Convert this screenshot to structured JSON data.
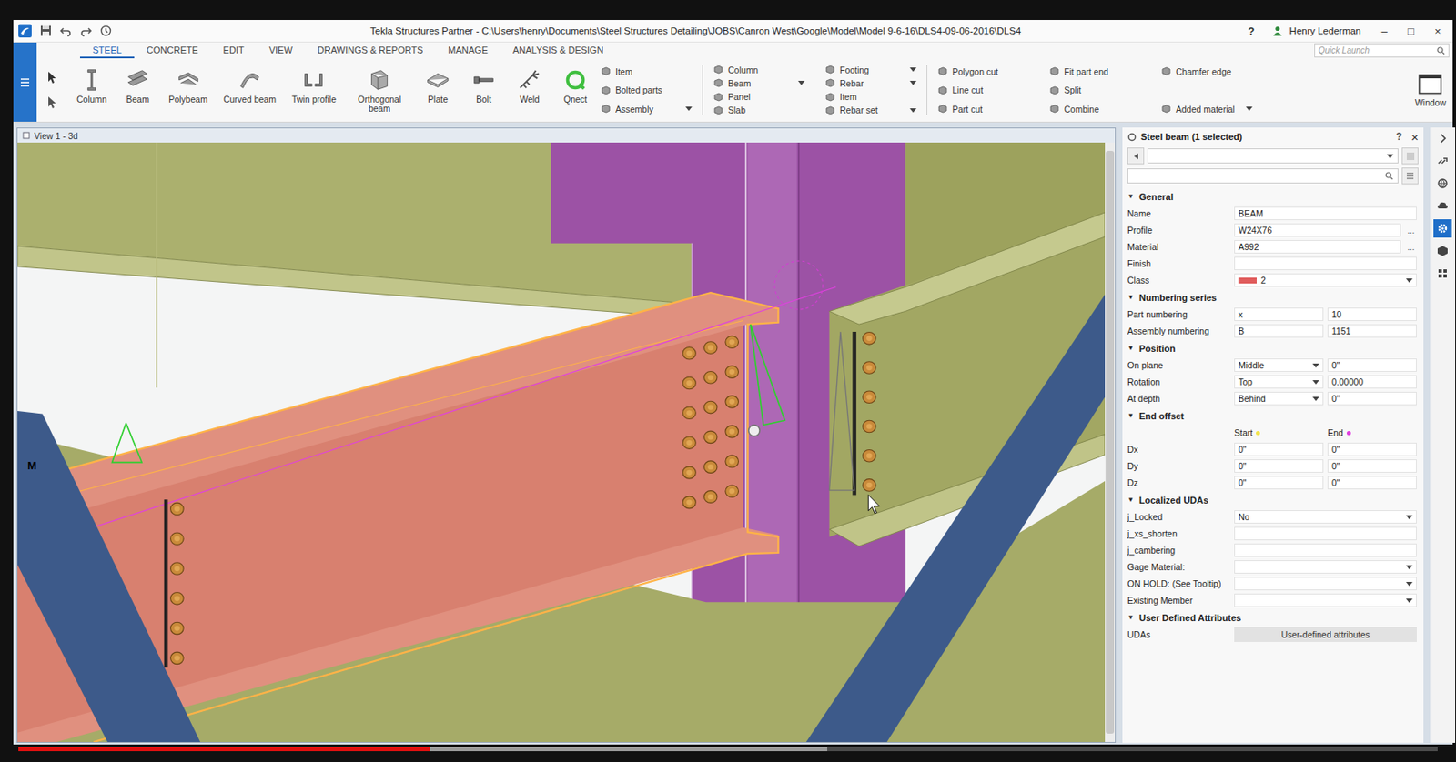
{
  "window": {
    "title": "Tekla Structures Partner - C:\\Users\\henry\\Documents\\Steel Structures Detailing\\JOBS\\Canron West\\Google\\Model\\Model 9-6-16\\DLS4-09-06-2016\\DLS4",
    "help": "?",
    "user": "Henry Lederman",
    "controls": [
      "–",
      "□",
      "×"
    ]
  },
  "ribbon_tabs": [
    {
      "label": "STEEL",
      "selected": true
    },
    {
      "label": "CONCRETE",
      "selected": false
    },
    {
      "label": "EDIT",
      "selected": false
    },
    {
      "label": "VIEW",
      "selected": false
    },
    {
      "label": "DRAWINGS & REPORTS",
      "selected": false
    },
    {
      "label": "MANAGE",
      "selected": false
    },
    {
      "label": "ANALYSIS & DESIGN",
      "selected": false
    }
  ],
  "quick_launch": {
    "placeholder": "Quick Launch"
  },
  "tools": [
    "Column",
    "Beam",
    "Polybeam",
    "Curved beam",
    "Twin profile",
    "Orthogonal beam",
    "Plate",
    "Bolt",
    "Weld",
    "Qnect"
  ],
  "tool_groups": [
    {
      "items": [
        {
          "label": "Item",
          "dropdown": false
        },
        {
          "label": "Bolted parts",
          "dropdown": false
        },
        {
          "label": "Assembly",
          "dropdown": true
        }
      ]
    },
    {
      "items": [
        {
          "label": "Column",
          "dropdown": false
        },
        {
          "label": "Beam",
          "dropdown": true
        },
        {
          "label": "Panel",
          "dropdown": false
        },
        {
          "label": "Slab",
          "dropdown": false
        }
      ]
    },
    {
      "items": [
        {
          "label": "Footing",
          "dropdown": true
        },
        {
          "label": "Rebar",
          "dropdown": true
        },
        {
          "label": "Item",
          "dropdown": false
        },
        {
          "label": "Rebar set",
          "dropdown": true
        }
      ]
    },
    {
      "items": [
        {
          "label": "Polygon cut",
          "dropdown": false
        },
        {
          "label": "Line cut",
          "dropdown": false
        },
        {
          "label": "Part cut",
          "dropdown": false
        }
      ]
    },
    {
      "items": [
        {
          "label": "Fit part end",
          "dropdown": false
        },
        {
          "label": "Split",
          "dropdown": false
        },
        {
          "label": "Combine",
          "dropdown": false
        }
      ]
    },
    {
      "items": [
        {
          "label": "Chamfer edge",
          "dropdown": false
        },
        {
          "label": "Added material",
          "dropdown": true
        }
      ]
    }
  ],
  "window_button": "Window",
  "view": {
    "tab": "View 1 - 3d",
    "marker": "M"
  },
  "properties": {
    "title": "Steel beam (1 selected)",
    "help": "?",
    "close": "×",
    "glyphs": {
      "expanded": "▼",
      "collapsed": "▶"
    },
    "sections": [
      {
        "title": "General",
        "expanded": true,
        "rows": [
          {
            "kind": "text",
            "label": "Name",
            "value": "BEAM"
          },
          {
            "kind": "browse",
            "label": "Profile",
            "value": "W24X76",
            "button": "..."
          },
          {
            "kind": "browse",
            "label": "Material",
            "value": "A992",
            "button": "..."
          },
          {
            "kind": "text",
            "label": "Finish",
            "value": ""
          },
          {
            "kind": "color-select",
            "label": "Class",
            "value": "2",
            "color": "#e05c5c"
          }
        ]
      },
      {
        "title": "Numbering series",
        "expanded": true,
        "rows": [
          {
            "kind": "pair",
            "label": "Part numbering",
            "values": [
              "x",
              "10"
            ]
          },
          {
            "kind": "pair",
            "label": "Assembly numbering",
            "values": [
              "B",
              "1151"
            ]
          }
        ]
      },
      {
        "title": "Position",
        "expanded": true,
        "rows": [
          {
            "kind": "select-pair",
            "label": "On plane",
            "values": [
              "Middle",
              "0\""
            ]
          },
          {
            "kind": "select-pair",
            "label": "Rotation",
            "values": [
              "Top",
              "0.00000"
            ]
          },
          {
            "kind": "select-pair",
            "label": "At depth",
            "values": [
              "Behind",
              "0\""
            ]
          }
        ]
      },
      {
        "title": "End offset",
        "expanded": true,
        "rows": [
          {
            "kind": "header",
            "label": "",
            "columns": [
              {
                "text": "Start",
                "color": "#f2e34a"
              },
              {
                "text": "End",
                "color": "#e03ce0"
              }
            ]
          },
          {
            "kind": "pair",
            "label": "Dx",
            "values": [
              "0\"",
              "0\""
            ]
          },
          {
            "kind": "pair",
            "label": "Dy",
            "values": [
              "0\"",
              "0\""
            ]
          },
          {
            "kind": "pair",
            "label": "Dz",
            "values": [
              "0\"",
              "0\""
            ]
          }
        ]
      },
      {
        "title": "Localized UDAs",
        "expanded": true,
        "rows": [
          {
            "kind": "select",
            "label": "j_Locked",
            "value": "No"
          },
          {
            "kind": "text",
            "label": "j_xs_shorten",
            "value": ""
          },
          {
            "kind": "text",
            "label": "j_cambering",
            "value": ""
          },
          {
            "kind": "select",
            "label": "Gage Material:",
            "value": ""
          },
          {
            "kind": "select",
            "label": "ON HOLD: (See Tooltip)",
            "value": ""
          },
          {
            "kind": "select",
            "label": "Existing Member",
            "value": ""
          }
        ]
      },
      {
        "title": "User Defined Attributes",
        "expanded": true,
        "rows": [
          {
            "kind": "button",
            "label": "UDAs",
            "value": "User-defined attributes"
          }
        ]
      }
    ]
  },
  "side_tools": [
    {
      "selected": false
    },
    {
      "selected": false
    },
    {
      "selected": false
    },
    {
      "selected": false
    },
    {
      "selected": true
    },
    {
      "selected": false
    },
    {
      "selected": false
    }
  ],
  "video": {
    "played": 0.29,
    "buffered": 0.57
  }
}
